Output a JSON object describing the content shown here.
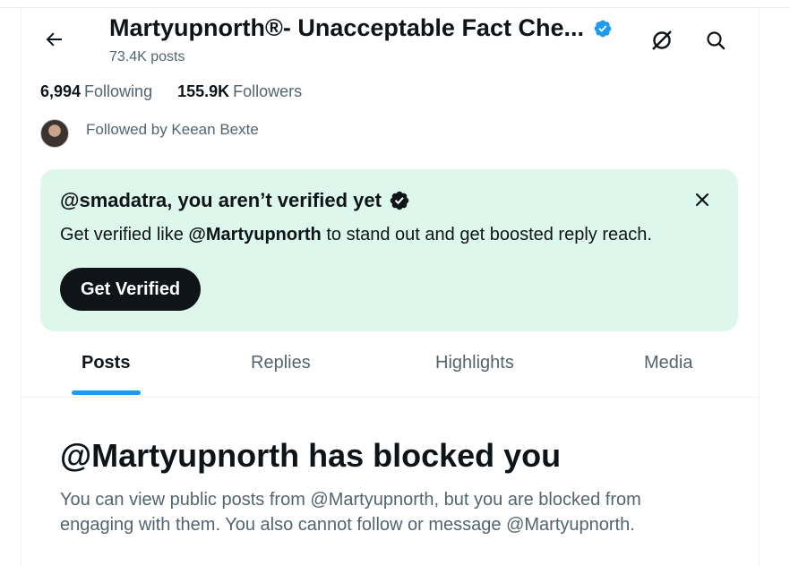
{
  "header": {
    "title": "Martyupnorth®- Unacceptable Fact Che...",
    "post_count": "73.4K posts",
    "back_icon": "arrow-left-icon",
    "grok_icon": "grok-icon",
    "search_icon": "search-icon"
  },
  "stats": {
    "following_count": "6,994",
    "following_label": "Following",
    "followers_count": "155.9K",
    "followers_label": "Followers"
  },
  "followed_by": "Followed by Keean Bexte",
  "banner": {
    "title": "@smadatra, you aren’t verified yet",
    "body_prefix": "Get verified like ",
    "body_handle": "@Martyupnorth",
    "body_suffix": " to stand out and get boosted reply reach.",
    "button_label": "Get Verified",
    "bg_color": "#def7ec"
  },
  "tabs": [
    {
      "label": "Posts",
      "active": true
    },
    {
      "label": "Replies",
      "active": false
    },
    {
      "label": "Highlights",
      "active": false
    },
    {
      "label": "Media",
      "active": false
    }
  ],
  "blocked": {
    "title": "@Martyupnorth has blocked you",
    "body": "You can view public posts from @Martyupnorth, but you are blocked from engaging with them. You also cannot follow or message @Martyupnorth."
  },
  "colors": {
    "accent": "#1d9bf0",
    "text": "#0f1419",
    "secondary": "#536471"
  }
}
